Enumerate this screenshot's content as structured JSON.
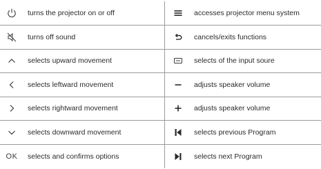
{
  "rows": [
    {
      "left": {
        "icon": "power-icon",
        "text": "turns the projector on or off"
      },
      "right": {
        "icon": "menu-icon",
        "text": "accesses projector menu system"
      }
    },
    {
      "left": {
        "icon": "mute-icon",
        "text": "turns off sound"
      },
      "right": {
        "icon": "return-icon",
        "text": "cancels/exits functions"
      }
    },
    {
      "left": {
        "icon": "chevron-up-icon",
        "text": "selects upward movement"
      },
      "right": {
        "icon": "input-source-icon",
        "text": "selects of the input soure"
      }
    },
    {
      "left": {
        "icon": "chevron-left-icon",
        "text": "selects leftward movement"
      },
      "right": {
        "icon": "minus-icon",
        "text": "adjusts speaker volume"
      }
    },
    {
      "left": {
        "icon": "chevron-right-icon",
        "text": "selects rightward movement"
      },
      "right": {
        "icon": "plus-icon",
        "text": "adjusts speaker volume"
      }
    },
    {
      "left": {
        "icon": "chevron-down-icon",
        "text": "selects downward movement"
      },
      "right": {
        "icon": "previous-icon",
        "text": "selects previous Program"
      }
    },
    {
      "left": {
        "icon": "ok-text",
        "label": "OK",
        "text": "selects and confirms options"
      },
      "right": {
        "icon": "next-icon",
        "text": "selects next Program"
      }
    }
  ]
}
